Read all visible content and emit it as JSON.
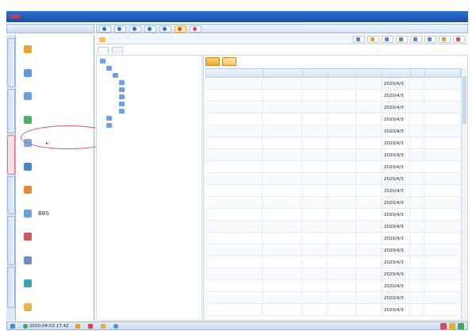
{
  "menubar": [
    "",
    "",
    "",
    "",
    "",
    "",
    "",
    "",
    "",
    "",
    "",
    "",
    "",
    "",
    "",
    ""
  ],
  "titlebar": {
    "brand_prefix": "",
    "brand_red": "DEE",
    "brand_suffix": "",
    "notices": [
      "",
      "",
      "",
      ""
    ]
  },
  "sidebar": {
    "header": "",
    "vtabs": [
      "",
      "",
      "",
      "",
      "",
      ""
    ],
    "items": [
      {
        "label": "",
        "icon": "pencil-icon",
        "color": "#e4a43a"
      },
      {
        "label": "",
        "icon": "calendar-icon",
        "color": "#5a9ad8"
      },
      {
        "label": "",
        "icon": "mail-icon",
        "color": "#6aa0d8"
      },
      {
        "label": "",
        "icon": "globe-icon",
        "color": "#4caf6a"
      },
      {
        "label": "",
        "icon": "document-icon",
        "color": "#7aa7dd",
        "arrow": "▸"
      },
      {
        "label": "",
        "icon": "flow-icon",
        "color": "#3f8ad0"
      },
      {
        "label": "",
        "icon": "person-icon",
        "color": "#e28a3a"
      },
      {
        "label": "BBS",
        "icon": "forum-icon",
        "color": "#6aa0d8"
      },
      {
        "label": "",
        "icon": "calendar-icon",
        "color": "#cf5a5a"
      },
      {
        "label": "",
        "icon": "wrench-icon",
        "color": "#6b8fbf"
      },
      {
        "label": "",
        "icon": "gear-icon",
        "color": "#3aa0b8"
      },
      {
        "label": "",
        "icon": "folder-icon",
        "color": "#e8b24a"
      }
    ]
  },
  "toolbar1": [
    {
      "label": "",
      "active": false,
      "color": "#2b6fcf"
    },
    {
      "label": "",
      "active": false,
      "color": "#2b6fcf"
    },
    {
      "label": "",
      "active": false,
      "color": "#2b6fcf"
    },
    {
      "label": "",
      "active": false,
      "color": "#2b6fcf"
    },
    {
      "label": "",
      "active": false,
      "color": "#2b6fcf"
    },
    {
      "label": "",
      "active": true,
      "color": "#d84a4a"
    },
    {
      "label": "",
      "active": false,
      "color": "#d84a4a"
    }
  ],
  "toolbar2": {
    "path": "",
    "actions": [
      {
        "label": "",
        "color": "#4a8ad8"
      },
      {
        "label": "",
        "color": "#e0a030"
      },
      {
        "label": "",
        "color": "#4a8ad8"
      },
      {
        "label": "",
        "color": "#4aa060"
      },
      {
        "label": "",
        "color": "#4a8ad8"
      },
      {
        "label": "",
        "color": "#4a8ad8"
      },
      {
        "label": "",
        "color": "#e0a030"
      },
      {
        "label": "",
        "color": "#d84a4a"
      }
    ]
  },
  "subtabs": [
    "",
    ""
  ],
  "tree": [
    {
      "label": "",
      "level": 0,
      "sel": true
    },
    {
      "label": "",
      "level": 1
    },
    {
      "label": "",
      "level": 2
    },
    {
      "label": "",
      "level": 3
    },
    {
      "label": "",
      "level": 3
    },
    {
      "label": "",
      "level": 3
    },
    {
      "label": "",
      "level": 3
    },
    {
      "label": "",
      "level": 3
    },
    {
      "label": "",
      "level": 1
    },
    {
      "label": "",
      "level": 1
    }
  ],
  "grid": {
    "tabs": [
      "",
      ""
    ],
    "columns": [
      "",
      "",
      "",
      "",
      "",
      "",
      ""
    ],
    "rows": [
      [
        "",
        "",
        "",
        "",
        "",
        "2020/4/3",
        ""
      ],
      [
        "",
        "",
        "",
        "",
        "",
        "2020/4/3",
        ""
      ],
      [
        "",
        "",
        "",
        "",
        "",
        "2020/4/3",
        ""
      ],
      [
        "",
        "",
        "",
        "",
        "",
        "2020/4/3",
        ""
      ],
      [
        "",
        "",
        "",
        "",
        "",
        "2020/4/3",
        ""
      ],
      [
        "",
        "",
        "",
        "",
        "",
        "2020/4/3",
        ""
      ],
      [
        "",
        "",
        "",
        "",
        "",
        "2020/4/3",
        ""
      ],
      [
        "",
        "",
        "",
        "",
        "",
        "2020/4/3",
        ""
      ],
      [
        "",
        "",
        "",
        "",
        "",
        "2020/4/3",
        ""
      ],
      [
        "",
        "",
        "",
        "",
        "",
        "2020/4/3",
        ""
      ],
      [
        "",
        "",
        "",
        "",
        "",
        "2020/4/3",
        ""
      ],
      [
        "",
        "",
        "",
        "",
        "",
        "2020/4/3",
        ""
      ],
      [
        "",
        "",
        "",
        "",
        "",
        "2020/4/3",
        ""
      ],
      [
        "",
        "",
        "",
        "",
        "",
        "2020/4/3",
        ""
      ],
      [
        "",
        "",
        "",
        "",
        "",
        "2020/4/3",
        ""
      ],
      [
        "",
        "",
        "",
        "",
        "",
        "2020/4/3",
        ""
      ],
      [
        "",
        "",
        "",
        "",
        "",
        "2020/4/3",
        ""
      ],
      [
        "",
        "",
        "",
        "",
        "",
        "2020/4/3",
        ""
      ],
      [
        "",
        "",
        "",
        "",
        "",
        "2020/4/3",
        ""
      ],
      [
        "",
        "",
        "",
        "",
        "",
        "2020/4/3",
        ""
      ]
    ]
  },
  "statusbar": {
    "user": "",
    "datetime": "2020-04-03 17:42",
    "items": [
      "",
      "",
      "",
      ""
    ],
    "company": ""
  }
}
